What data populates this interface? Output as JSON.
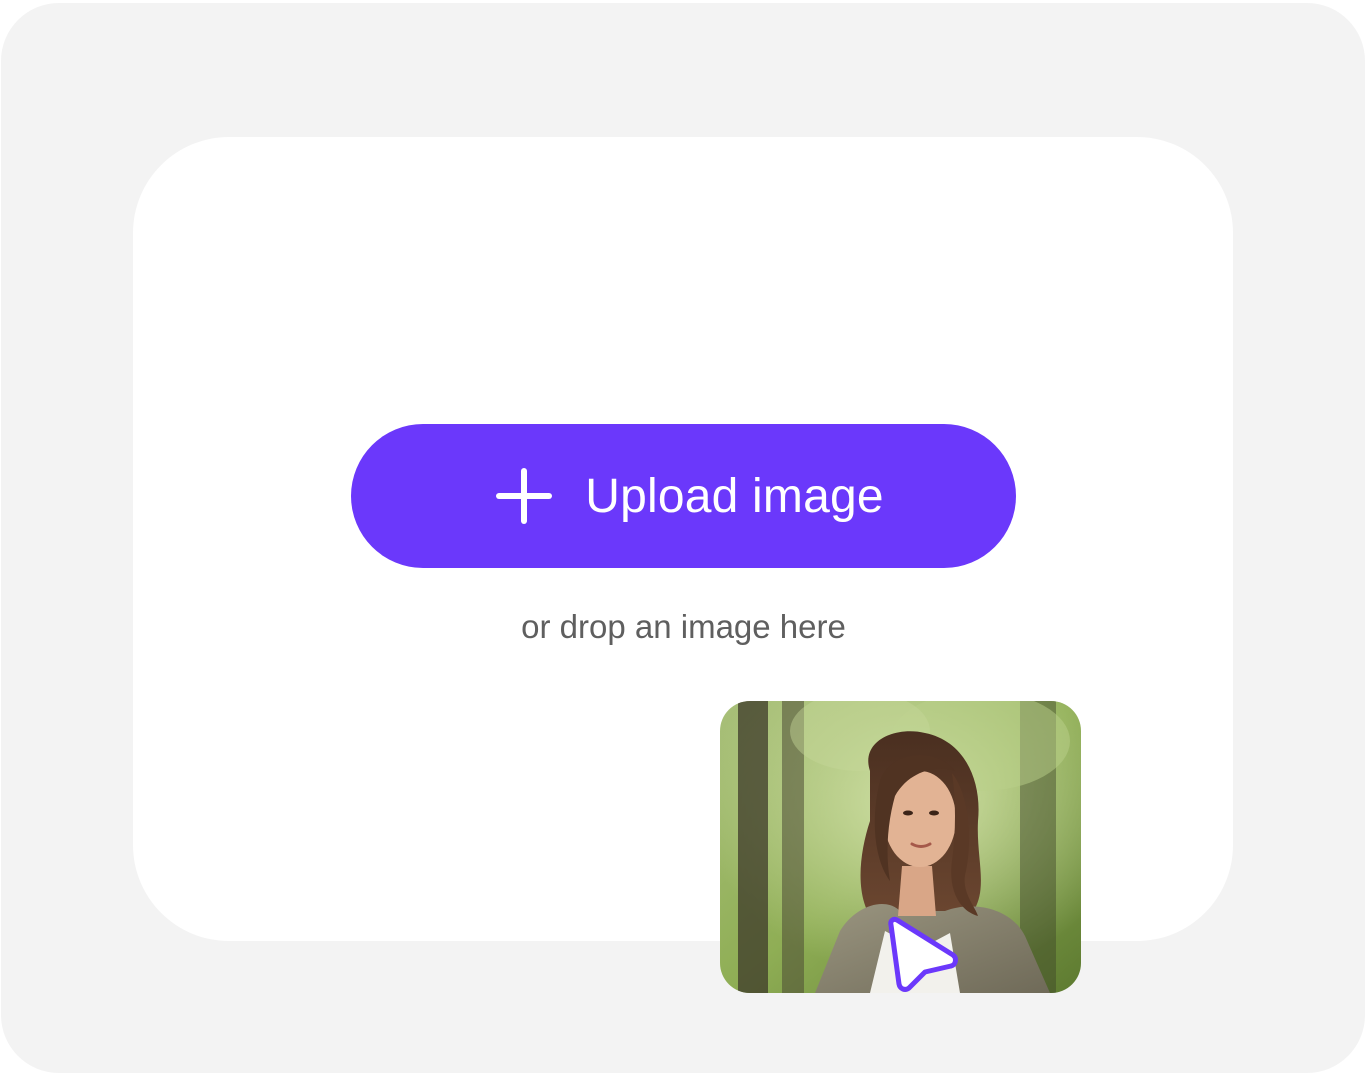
{
  "upload": {
    "button_label": "Upload image",
    "button_icon": "plus-icon",
    "drop_hint": "or drop an image here"
  },
  "preview": {
    "image_description_icon": "portrait-photo",
    "cursor_icon": "pointer-cursor-icon"
  },
  "colors": {
    "accent": "#6b38fb",
    "background": "#f3f3f3",
    "panel": "#ffffff",
    "hint_text": "#5f5f5f"
  }
}
